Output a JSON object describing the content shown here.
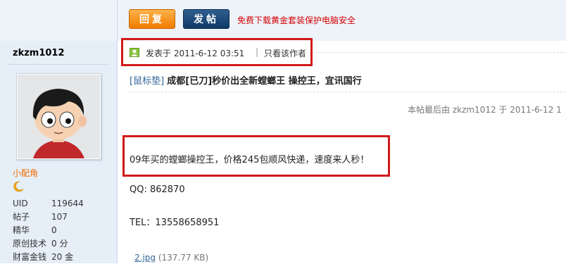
{
  "toolbar": {
    "reply_label": "回复",
    "post_label": "发帖",
    "promo_text": "免费下载黄金套装保护电脑安全"
  },
  "user": {
    "username": "zkzm1012",
    "rank_title": "小配角",
    "rank_icon": "moon-icon",
    "stats": [
      {
        "label": "UID",
        "value": "119644"
      },
      {
        "label": "帖子",
        "value": "107"
      },
      {
        "label": "精华",
        "value": "0"
      },
      {
        "label": "原创技术",
        "value": "0 分"
      },
      {
        "label": "财富金钱",
        "value": "20 金"
      }
    ]
  },
  "post": {
    "posted_at": "发表于 2011-6-12 03:51",
    "author_only": "只看该作者",
    "title_tag": "[鼠标垫]",
    "title_text": "成都[已刀]秒价出全新螳螂王 操控王，宜讯国行",
    "edit_note": "本帖最后由 zkzm1012 于 2011-6-12 1",
    "content_line1": "09年买的螳螂操控王，价格245包顺风快递，速度来人秒！",
    "content_qq": "QQ:  862870",
    "content_tel": "TEL：13558658951",
    "attachment_name": "2.jpg",
    "attachment_size": "(137.77 KB)"
  },
  "colors": {
    "reply_button": "#f07c00",
    "post_button": "#0f3a66",
    "promo_text": "#d40000",
    "highlight_box": "#d01a1a",
    "rank_title": "#f26c00"
  }
}
